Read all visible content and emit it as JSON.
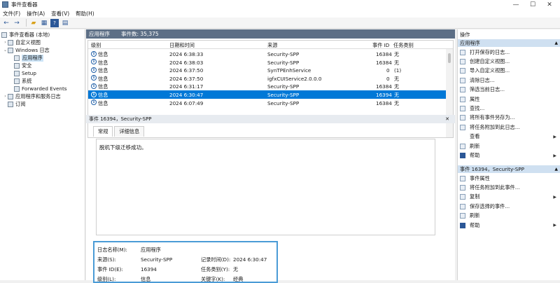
{
  "window": {
    "title": "事件查看器",
    "minimize": "—",
    "maximize": "☐",
    "close": "✕"
  },
  "menu": [
    "文件(F)",
    "操作(A)",
    "查看(V)",
    "帮助(H)"
  ],
  "tree": [
    {
      "label": "事件查看器 (本地)",
      "expand": "",
      "indent": 0
    },
    {
      "label": "自定义视图",
      "expand": "›",
      "indent": 1
    },
    {
      "label": "Windows 日志",
      "expand": "⌄",
      "indent": 1
    },
    {
      "label": "应用程序",
      "expand": "",
      "indent": 2,
      "selected": true
    },
    {
      "label": "安全",
      "expand": "",
      "indent": 2
    },
    {
      "label": "Setup",
      "expand": "",
      "indent": 2
    },
    {
      "label": "系统",
      "expand": "",
      "indent": 2
    },
    {
      "label": "Forwarded Events",
      "expand": "",
      "indent": 2
    },
    {
      "label": "应用程序和服务日志",
      "expand": "›",
      "indent": 1
    },
    {
      "label": "订阅",
      "expand": "",
      "indent": 1
    }
  ],
  "list_panel": {
    "name": "应用程序",
    "count_label": "事件数: 35,375"
  },
  "columns": [
    "级别",
    "日期和时间",
    "来源",
    "事件 ID",
    "任务类别"
  ],
  "rows": [
    {
      "level": "信息",
      "datetime": "2024 6:38:33",
      "source": "Security-SPP",
      "id": "16384",
      "task": "无"
    },
    {
      "level": "信息",
      "datetime": "2024 6:38:03",
      "source": "Security-SPP",
      "id": "16384",
      "task": "无"
    },
    {
      "level": "信息",
      "datetime": "2024 6:37:50",
      "source": "SynTPEnhService",
      "id": "0",
      "task": "(1)"
    },
    {
      "level": "信息",
      "datetime": "2024 6:37:50",
      "source": "igfxCUIService2.0.0.0",
      "id": "0",
      "task": "无"
    },
    {
      "level": "信息",
      "datetime": "2024 6:31:17",
      "source": "Security-SPP",
      "id": "16384",
      "task": "无"
    },
    {
      "level": "信息",
      "datetime": "2024 6:30:47",
      "source": "Security-SPP",
      "id": "16394",
      "task": "无",
      "selected": true
    },
    {
      "level": "信息",
      "datetime": "2024 6:07:49",
      "source": "Security-SPP",
      "id": "16384",
      "task": "无"
    }
  ],
  "detail": {
    "header": "事件 16394，Security-SPP",
    "tabs": [
      "常规",
      "详细信息"
    ],
    "message": "脱机下级迁移成功。",
    "props": {
      "logname_label": "日志名称(M):",
      "logname": "应用程序",
      "source_label": "来源(S):",
      "source": "Security-SPP",
      "recorded_label": "记录时间(D):",
      "recorded": "2024 6:30:47",
      "eventid_label": "事件 ID(E):",
      "eventid": "16394",
      "task_label": "任务类别(Y):",
      "task": "无",
      "level_label": "级别(L):",
      "level": "信息",
      "keywords_label": "关键字(K):",
      "keywords": "经典"
    }
  },
  "actions": {
    "title": "操作",
    "section1": "应用程序",
    "items1": [
      {
        "label": "打开保存的日志...",
        "icon": "folder-icon"
      },
      {
        "label": "创建自定义视图...",
        "icon": "filter-icon"
      },
      {
        "label": "导入自定义视图...",
        "icon": "import-icon"
      },
      {
        "label": "清除日志...",
        "icon": "clear-icon"
      },
      {
        "label": "筛选当前日志...",
        "icon": "filter-icon"
      },
      {
        "label": "属性",
        "icon": "properties-icon"
      },
      {
        "label": "查找...",
        "icon": "find-icon"
      },
      {
        "label": "将所有事件另存为...",
        "icon": "save-icon"
      },
      {
        "label": "将任务附加到此日志...",
        "icon": "task-icon"
      },
      {
        "label": "查看",
        "icon": "view-icon",
        "submenu": true
      },
      {
        "label": "刷新",
        "icon": "refresh-icon"
      },
      {
        "label": "帮助",
        "icon": "help-icon",
        "submenu": true
      }
    ],
    "section2": "事件 16394，Security-SPP",
    "items2": [
      {
        "label": "事件属性",
        "icon": "properties-icon"
      },
      {
        "label": "将任务附加到此事件...",
        "icon": "task-icon"
      },
      {
        "label": "复制",
        "icon": "copy-icon",
        "submenu": true
      },
      {
        "label": "保存选择的事件...",
        "icon": "save-icon"
      },
      {
        "label": "刷新",
        "icon": "refresh-icon"
      },
      {
        "label": "帮助",
        "icon": "help-icon",
        "submenu": true
      }
    ]
  }
}
